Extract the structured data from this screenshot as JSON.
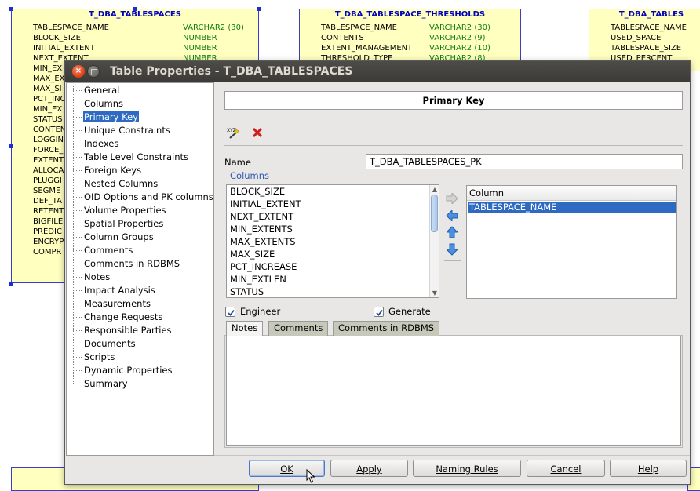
{
  "diagram": {
    "entities": [
      {
        "title": "T_DBA_TABLESPACES",
        "rows": [
          {
            "name": "TABLESPACE_NAME",
            "type": "VARCHAR2 (30)"
          },
          {
            "name": "BLOCK_SIZE",
            "type": "NUMBER"
          },
          {
            "name": "INITIAL_EXTENT",
            "type": "NUMBER"
          },
          {
            "name": "NEXT_EXTENT",
            "type": "NUMBER"
          },
          {
            "name": "MIN_EX",
            "type": ""
          },
          {
            "name": "MAX_EX",
            "type": ""
          },
          {
            "name": "MAX_SI",
            "type": ""
          },
          {
            "name": "PCT_INC",
            "type": ""
          },
          {
            "name": "MIN_EX",
            "type": ""
          },
          {
            "name": "STATUS",
            "type": ""
          },
          {
            "name": "CONTEN",
            "type": ""
          },
          {
            "name": "LOGGIN",
            "type": ""
          },
          {
            "name": "FORCE_",
            "type": ""
          },
          {
            "name": "EXTENT",
            "type": ""
          },
          {
            "name": "ALLOCA",
            "type": ""
          },
          {
            "name": "PLUGGI",
            "type": ""
          },
          {
            "name": "SEGME",
            "type": ""
          },
          {
            "name": "DEF_TA",
            "type": ""
          },
          {
            "name": "RETENT",
            "type": ""
          },
          {
            "name": "BIGFILE",
            "type": ""
          },
          {
            "name": "PREDIC",
            "type": ""
          },
          {
            "name": "ENCRYP",
            "type": ""
          },
          {
            "name": "COMPR",
            "type": ""
          }
        ]
      },
      {
        "title": "T_DBA_TABLESPACE_THRESHOLDS",
        "rows": [
          {
            "name": "TABLESPACE_NAME",
            "type": "VARCHAR2 (30)"
          },
          {
            "name": "CONTENTS",
            "type": "VARCHAR2 (9)"
          },
          {
            "name": "EXTENT_MANAGEMENT",
            "type": "VARCHAR2 (10)"
          },
          {
            "name": "THRESHOLD_TYPE",
            "type": "VARCHAR2 (8)"
          }
        ]
      },
      {
        "title": "T_DBA_TABLES",
        "rows": [
          {
            "name": "TABLESPACE_NAME",
            "type": ""
          },
          {
            "name": "USED_SPACE",
            "type": ""
          },
          {
            "name": "TABLESPACE_SIZE",
            "type": ""
          },
          {
            "name": "USED_PERCENT",
            "type": ""
          }
        ]
      }
    ]
  },
  "dialog": {
    "title": "Table Properties - T_DBA_TABLESPACES",
    "close_glyph": "×",
    "nav_items": [
      "General",
      "Columns",
      "Primary Key",
      "Unique Constraints",
      "Indexes",
      "Table Level Constraints",
      "Foreign Keys",
      "Nested Columns",
      "OID Options and PK columns",
      "Volume Properties",
      "Spatial Properties",
      "Column Groups",
      "Comments",
      "Comments in RDBMS",
      "Notes",
      "Impact Analysis",
      "Measurements",
      "Change Requests",
      "Responsible Parties",
      "Documents",
      "Scripts",
      "Dynamic Properties",
      "Summary"
    ],
    "selected_nav": "Primary Key",
    "panel_title": "Primary Key",
    "name_label": "Name",
    "name_value": "T_DBA_TABLESPACES_PK",
    "columns_group_label": "Columns",
    "available_columns": [
      "BLOCK_SIZE",
      "INITIAL_EXTENT",
      "NEXT_EXTENT",
      "MIN_EXTENTS",
      "MAX_EXTENTS",
      "MAX_SIZE",
      "PCT_INCREASE",
      "MIN_EXTLEN",
      "STATUS"
    ],
    "selected_header": "Column",
    "selected_columns": [
      "TABLESPACE_NAME"
    ],
    "engineer_label": "Engineer",
    "engineer_checked": true,
    "generate_label": "Generate",
    "generate_checked": true,
    "tabs": [
      "Notes",
      "Comments",
      "Comments in RDBMS"
    ],
    "active_tab": "Notes",
    "notes_value": "",
    "buttons": {
      "ok": "OK",
      "apply": "Apply",
      "naming_rules": "Naming Rules",
      "cancel": "Cancel",
      "help": "Help"
    }
  },
  "colors": {
    "selection": "#2e6ac1",
    "entity_fill": "#ffffc0",
    "entity_border": "#3b3bd0",
    "type_text": "#108010",
    "group_title": "#2e58b5"
  }
}
